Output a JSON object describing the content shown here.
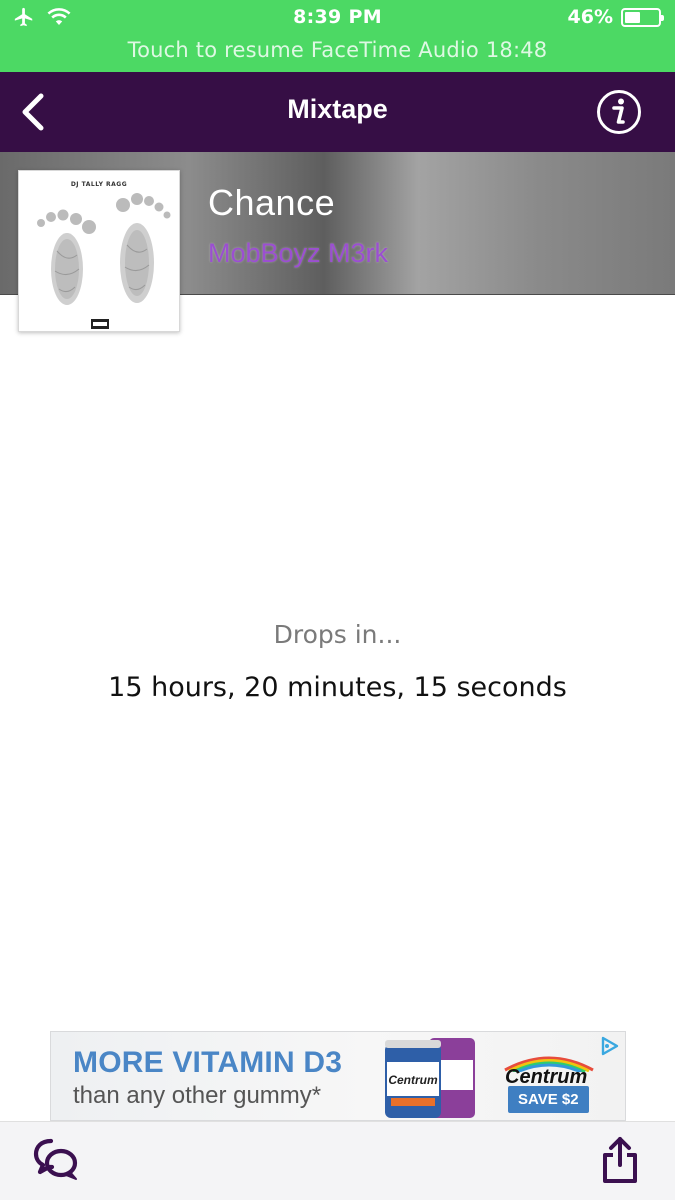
{
  "status_bar": {
    "time": "8:39 PM",
    "battery_text": "46%",
    "battery_level": 0.46,
    "icons": [
      "airplane-icon",
      "wifi-icon",
      "battery-icon"
    ],
    "facetime_banner": "Touch to resume FaceTime Audio 18:48",
    "color": "#4cd964"
  },
  "navbar": {
    "title": "Mixtape",
    "back_icon": "chevron-left-icon",
    "info_icon": "info-icon",
    "color": "#360e45"
  },
  "release": {
    "title": "Chance",
    "artist": "MobBoyz M3rk",
    "artwork_caption": "DJ TALLY RAGG",
    "artist_color": "#9b4fd1"
  },
  "countdown": {
    "label": "Drops in...",
    "value": "15 hours, 20 minutes, 15 seconds"
  },
  "ad": {
    "headline": "MORE VITAMIN D3",
    "subline": "than any other gummy*",
    "brand": "Centrum",
    "cta": "SAVE $2",
    "icon": "adchoices-icon"
  },
  "toolbar": {
    "left_icon": "chat-bubbles-icon",
    "right_icon": "share-icon"
  }
}
